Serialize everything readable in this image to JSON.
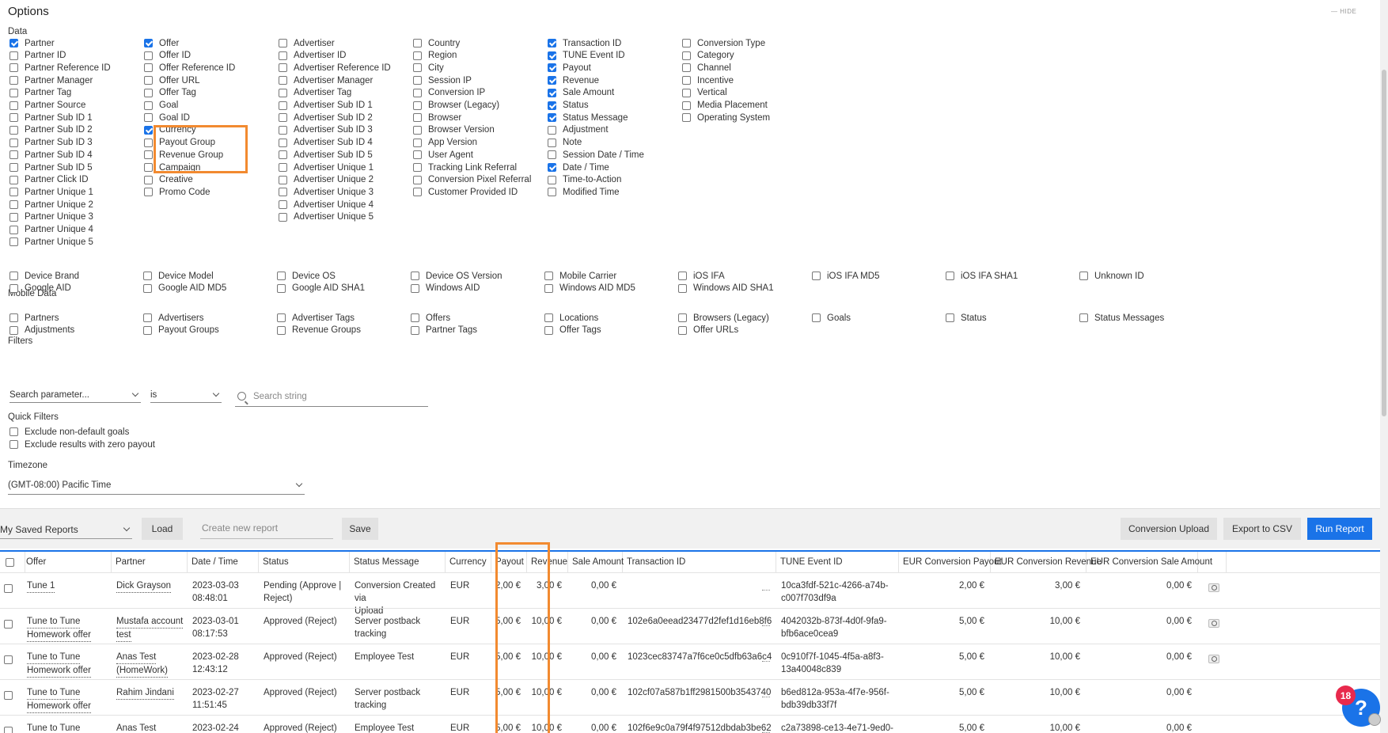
{
  "options": {
    "title": "Options",
    "hide_label": "HIDE",
    "sections": {
      "data": "Data",
      "mobile_data": "Mobile Data",
      "filters": "Filters",
      "quick_filters": "Quick Filters",
      "timezone": "Timezone"
    },
    "data_columns": [
      [
        {
          "label": "Partner",
          "checked": true
        },
        {
          "label": "Partner ID",
          "checked": false
        },
        {
          "label": "Partner Reference ID",
          "checked": false
        },
        {
          "label": "Partner Manager",
          "checked": false
        },
        {
          "label": "Partner Tag",
          "checked": false
        },
        {
          "label": "Partner Source",
          "checked": false
        },
        {
          "label": "Partner Sub ID 1",
          "checked": false
        },
        {
          "label": "Partner Sub ID 2",
          "checked": false
        },
        {
          "label": "Partner Sub ID 3",
          "checked": false
        },
        {
          "label": "Partner Sub ID 4",
          "checked": false
        },
        {
          "label": "Partner Sub ID 5",
          "checked": false
        },
        {
          "label": "Partner Click ID",
          "checked": false
        },
        {
          "label": "Partner Unique 1",
          "checked": false
        },
        {
          "label": "Partner Unique 2",
          "checked": false
        },
        {
          "label": "Partner Unique 3",
          "checked": false
        },
        {
          "label": "Partner Unique 4",
          "checked": false
        },
        {
          "label": "Partner Unique 5",
          "checked": false
        }
      ],
      [
        {
          "label": "Offer",
          "checked": true
        },
        {
          "label": "Offer ID",
          "checked": false
        },
        {
          "label": "Offer Reference ID",
          "checked": false
        },
        {
          "label": "Offer URL",
          "checked": false
        },
        {
          "label": "Offer Tag",
          "checked": false
        },
        {
          "label": "Goal",
          "checked": false
        },
        {
          "label": "Goal ID",
          "checked": false
        },
        {
          "label": "Currency",
          "checked": true
        },
        {
          "label": "Payout Group",
          "checked": false
        },
        {
          "label": "Revenue Group",
          "checked": false
        },
        {
          "label": "Campaign",
          "checked": false
        },
        {
          "label": "Creative",
          "checked": false
        },
        {
          "label": "Promo Code",
          "checked": false
        }
      ],
      [
        {
          "label": "Advertiser",
          "checked": false
        },
        {
          "label": "Advertiser ID",
          "checked": false
        },
        {
          "label": "Advertiser Reference ID",
          "checked": false
        },
        {
          "label": "Advertiser Manager",
          "checked": false
        },
        {
          "label": "Advertiser Tag",
          "checked": false
        },
        {
          "label": "Advertiser Sub ID 1",
          "checked": false
        },
        {
          "label": "Advertiser Sub ID 2",
          "checked": false
        },
        {
          "label": "Advertiser Sub ID 3",
          "checked": false
        },
        {
          "label": "Advertiser Sub ID 4",
          "checked": false
        },
        {
          "label": "Advertiser Sub ID 5",
          "checked": false
        },
        {
          "label": "Advertiser Unique 1",
          "checked": false
        },
        {
          "label": "Advertiser Unique 2",
          "checked": false
        },
        {
          "label": "Advertiser Unique 3",
          "checked": false
        },
        {
          "label": "Advertiser Unique 4",
          "checked": false
        },
        {
          "label": "Advertiser Unique 5",
          "checked": false
        }
      ],
      [
        {
          "label": "Country",
          "checked": false
        },
        {
          "label": "Region",
          "checked": false
        },
        {
          "label": "City",
          "checked": false
        },
        {
          "label": "Session IP",
          "checked": false
        },
        {
          "label": "Conversion IP",
          "checked": false
        },
        {
          "label": "Browser (Legacy)",
          "checked": false
        },
        {
          "label": "Browser",
          "checked": false
        },
        {
          "label": "Browser Version",
          "checked": false
        },
        {
          "label": "App Version",
          "checked": false
        },
        {
          "label": "User Agent",
          "checked": false
        },
        {
          "label": "Tracking Link Referral",
          "checked": false
        },
        {
          "label": "Conversion Pixel Referral",
          "checked": false
        },
        {
          "label": "Customer Provided ID",
          "checked": false
        }
      ],
      [
        {
          "label": "Transaction ID",
          "checked": true
        },
        {
          "label": "TUNE Event ID",
          "checked": true
        },
        {
          "label": "Payout",
          "checked": true
        },
        {
          "label": "Revenue",
          "checked": true
        },
        {
          "label": "Sale Amount",
          "checked": true
        },
        {
          "label": "Status",
          "checked": true
        },
        {
          "label": "Status Message",
          "checked": true
        },
        {
          "label": "Adjustment",
          "checked": false
        },
        {
          "label": "Note",
          "checked": false
        },
        {
          "label": "Session Date / Time",
          "checked": false
        },
        {
          "label": "Date / Time",
          "checked": true
        },
        {
          "label": "Time-to-Action",
          "checked": false
        },
        {
          "label": "Modified Time",
          "checked": false
        }
      ],
      [
        {
          "label": "Conversion Type",
          "checked": false
        },
        {
          "label": "Category",
          "checked": false
        },
        {
          "label": "Channel",
          "checked": false
        },
        {
          "label": "Incentive",
          "checked": false
        },
        {
          "label": "Vertical",
          "checked": false
        },
        {
          "label": "Media Placement",
          "checked": false
        },
        {
          "label": "Operating System",
          "checked": false
        }
      ]
    ],
    "mobile_rows": [
      [
        "Device Brand",
        "Device Model",
        "Device OS",
        "Device OS Version",
        "Mobile Carrier",
        "iOS IFA",
        "iOS IFA MD5",
        "iOS IFA SHA1",
        "Unknown ID"
      ],
      [
        "Google AID",
        "Google AID MD5",
        "Google AID SHA1",
        "Windows AID",
        "Windows AID MD5",
        "Windows AID SHA1"
      ]
    ],
    "filter_rows": [
      [
        "Partners",
        "Advertisers",
        "Advertiser Tags",
        "Offers",
        "Locations",
        "Browsers (Legacy)",
        "Goals",
        "Status",
        "Status Messages"
      ],
      [
        "Adjustments",
        "Payout Groups",
        "Revenue Groups",
        "Partner Tags",
        "Offer Tags",
        "Offer URLs"
      ]
    ],
    "search_parameter_placeholder": "Search parameter...",
    "operator_value": "is",
    "search_string_placeholder": "Search string",
    "quick_filter_items": [
      "Exclude non-default goals",
      "Exclude results with zero payout"
    ],
    "timezone_value": "(GMT-08:00) Pacific Time"
  },
  "report_bar": {
    "saved_reports_label": "My Saved Reports",
    "load_label": "Load",
    "new_report_placeholder": "Create new report",
    "save_label": "Save",
    "conversion_upload_label": "Conversion Upload",
    "export_csv_label": "Export to CSV",
    "run_report_label": "Run Report"
  },
  "table": {
    "headers": [
      "Offer",
      "Partner",
      "Date / Time",
      "Status",
      "Status Message",
      "Currency",
      "Payout",
      "Revenue",
      "Sale Amount",
      "Transaction ID",
      "TUNE Event ID",
      "EUR Conversion Payout",
      "EUR Conversion Revenue",
      "EUR Conversion Sale Amount"
    ],
    "rows": [
      {
        "offer": [
          "Tune 1",
          ""
        ],
        "partner": [
          "Dick Grayson",
          ""
        ],
        "datetime": [
          "2023-03-03",
          "08:48:01"
        ],
        "status": [
          "Pending (Approve |",
          "Reject)"
        ],
        "status_message": [
          "Conversion Created via",
          "Upload"
        ],
        "currency": "EUR",
        "payout": "2,00 €",
        "revenue": "3,00 €",
        "sale_amount": "0,00 €",
        "transaction_id": "",
        "tune_event_id": [
          "10ca3fdf-521c-4266-a74b-",
          "c007f703df9a"
        ],
        "eur_payout": "2,00 €",
        "eur_revenue": "3,00 €",
        "eur_sale": "0,00 €"
      },
      {
        "offer": [
          "Tune to Tune",
          "Homework offer"
        ],
        "partner": [
          "Mustafa account",
          "test"
        ],
        "datetime": [
          "2023-03-01",
          "08:17:53"
        ],
        "status": [
          "Approved (Reject)",
          ""
        ],
        "status_message": [
          "Server postback tracking",
          ""
        ],
        "currency": "EUR",
        "payout": "5,00 €",
        "revenue": "10,00 €",
        "sale_amount": "0,00 €",
        "transaction_id": "102e6a0eead23477d2fef1d16eb8f6",
        "tune_event_id": [
          "4042032b-873f-4d0f-9fa9-",
          "bfb6ace0cea9"
        ],
        "eur_payout": "5,00 €",
        "eur_revenue": "10,00 €",
        "eur_sale": "0,00 €"
      },
      {
        "offer": [
          "Tune to Tune",
          "Homework offer"
        ],
        "partner": [
          "Anas Test",
          "(HomeWork)"
        ],
        "datetime": [
          "2023-02-28",
          "12:43:12"
        ],
        "status": [
          "Approved (Reject)",
          ""
        ],
        "status_message": [
          "Employee Test",
          ""
        ],
        "currency": "EUR",
        "payout": "5,00 €",
        "revenue": "10,00 €",
        "sale_amount": "0,00 €",
        "transaction_id": "1023cec83747a7f6ce0c5dfb63a6c4",
        "tune_event_id": [
          "0c910f7f-1045-4f5a-a8f3-",
          "13a40048c839"
        ],
        "eur_payout": "5,00 €",
        "eur_revenue": "10,00 €",
        "eur_sale": "0,00 €"
      },
      {
        "offer": [
          "Tune to Tune",
          "Homework offer"
        ],
        "partner": [
          "Rahim Jindani",
          ""
        ],
        "datetime": [
          "2023-02-27",
          "11:51:45"
        ],
        "status": [
          "Approved (Reject)",
          ""
        ],
        "status_message": [
          "Server postback tracking",
          ""
        ],
        "currency": "EUR",
        "payout": "5,00 €",
        "revenue": "10,00 €",
        "sale_amount": "0,00 €",
        "transaction_id": "102cf07a587b1ff2981500b3543740",
        "tune_event_id": [
          "b6ed812a-953a-4f7e-956f-",
          "bdb39db33f7f"
        ],
        "eur_payout": "5,00 €",
        "eur_revenue": "10,00 €",
        "eur_sale": "0,00 €"
      },
      {
        "offer": [
          "Tune to Tune",
          ""
        ],
        "partner": [
          "Anas Test",
          ""
        ],
        "datetime": [
          "2023-02-24",
          ""
        ],
        "status": [
          "Approved (Reject)",
          ""
        ],
        "status_message": [
          "Employee Test",
          ""
        ],
        "currency": "EUR",
        "payout": "5,00 €",
        "revenue": "10,00 €",
        "sale_amount": "0,00 €",
        "transaction_id": "102f6e9c0a79f4f97512dbdab3be62",
        "tune_event_id": [
          "c2a73898-ce13-4e71-9ed0-",
          ""
        ],
        "eur_payout": "5,00 €",
        "eur_revenue": "10,00 €",
        "eur_sale": "0,00 €"
      }
    ]
  },
  "help": {
    "badge_count": "18",
    "icon_glyph": "?"
  },
  "colors": {
    "accent": "#1a73e8",
    "highlight": "#f28a30",
    "badge": "#e8294c"
  }
}
